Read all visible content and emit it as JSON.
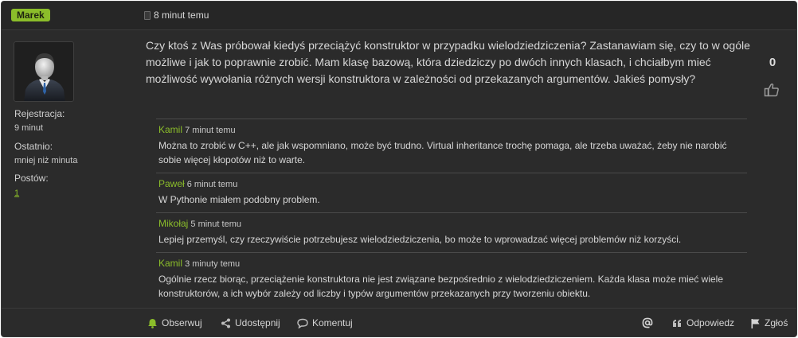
{
  "post": {
    "author": "Marek",
    "time": "8 minut temu",
    "question": "Czy ktoś z Was próbował kiedyś przeciążyć konstruktor w przypadku wielodziedziczenia? Zastanawiam się, czy to w ogóle możliwe i jak to poprawnie zrobić. Mam klasę bazową, która dziedziczy po dwóch innych klasach, i chciałbym mieć możliwość wywołania różnych wersji konstruktora w zależności od przekazanych argumentów. Jakieś pomysły?",
    "votes": "0"
  },
  "profile": {
    "registration_label": "Rejestracja:",
    "registration_value": "9 minut",
    "last_label": "Ostatnio:",
    "last_value": "mniej niż minuta",
    "posts_label": "Postów:",
    "posts_value": "1"
  },
  "comments": [
    {
      "author": "Kamil",
      "time": "7 minut temu",
      "text": "Można to zrobić w C++, ale jak wspomniano, może być trudno. Virtual inheritance trochę pomaga, ale trzeba uważać, żeby nie narobić sobie więcej kłopotów niż to warte."
    },
    {
      "author": "Paweł",
      "time": "6 minut temu",
      "text": "W Pythonie miałem podobny problem."
    },
    {
      "author": "Mikołaj",
      "time": "5 minut temu",
      "text": "Lepiej przemyśl, czy rzeczywiście potrzebujesz wielodziedziczenia, bo może to wprowadzać więcej problemów niż korzyści."
    },
    {
      "author": "Kamil",
      "time": "3 minuty temu",
      "text": "Ogólnie rzecz biorąc, przeciążenie konstruktora nie jest związane bezpośrednio z wielodziedziczeniem. Każda klasa może mieć wiele konstruktorów, a ich wybór zależy od liczby i typów argumentów przekazanych przy tworzeniu obiektu."
    }
  ],
  "footer": {
    "follow": "Obserwuj",
    "share": "Udostępnij",
    "comment": "Komentuj",
    "reply": "Odpowiedz",
    "report": "Zgłoś"
  },
  "icons": [
    "document-icon",
    "thumbs-up-icon",
    "bell-icon",
    "share-icon",
    "comment-icon",
    "at-icon",
    "quote-icon",
    "flag-icon"
  ],
  "colors": {
    "accent": "#8bbd2a",
    "background": "#2b2b2b"
  }
}
